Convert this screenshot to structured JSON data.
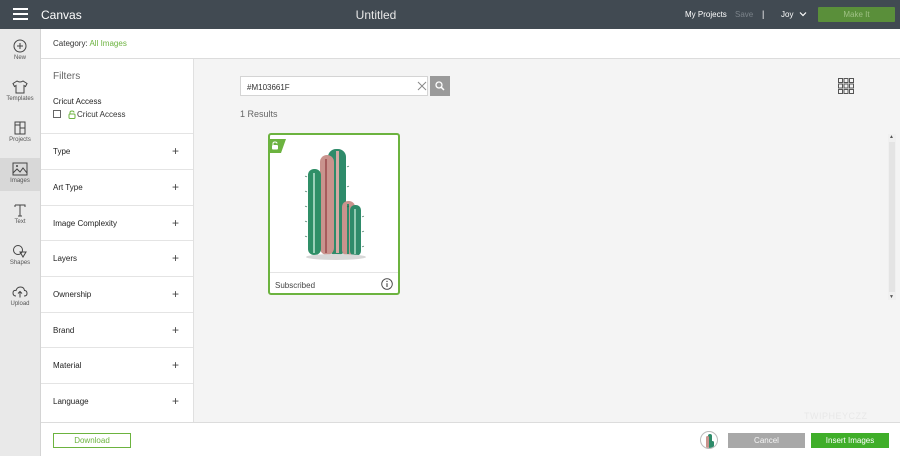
{
  "topbar": {
    "app_name": "Canvas",
    "doc_title": "Untitled",
    "my_projects": "My Projects",
    "save": "Save",
    "separator": "|",
    "user": "Joy",
    "make_it": "Make It"
  },
  "rail": {
    "items": [
      {
        "label": "New",
        "icon": "plus-circle-icon"
      },
      {
        "label": "Templates",
        "icon": "shirt-icon"
      },
      {
        "label": "Projects",
        "icon": "notebook-icon"
      },
      {
        "label": "Images",
        "icon": "image-icon",
        "active": true
      },
      {
        "label": "Text",
        "icon": "text-t-icon"
      },
      {
        "label": "Shapes",
        "icon": "shapes-icon"
      },
      {
        "label": "Upload",
        "icon": "cloud-upload-icon"
      }
    ]
  },
  "category": {
    "label": "Category:",
    "value": "All Images"
  },
  "filters": {
    "title": "Filters",
    "access_title": "Cricut Access",
    "access_option": "Cricut Access",
    "groups": [
      "Type",
      "Art Type",
      "Image Complexity",
      "Layers",
      "Ownership",
      "Brand",
      "Material",
      "Language"
    ]
  },
  "search": {
    "value": "#M103661F"
  },
  "results": {
    "count_text": "1 Results",
    "items": [
      {
        "status": "Subscribed"
      }
    ]
  },
  "footer": {
    "download": "Download",
    "cancel": "Cancel",
    "insert": "Insert Images",
    "watermark": "TWIPHEYCZZ"
  },
  "colors": {
    "accent": "#6cb33f",
    "topbar": "#414a52",
    "insert": "#3fae29"
  }
}
